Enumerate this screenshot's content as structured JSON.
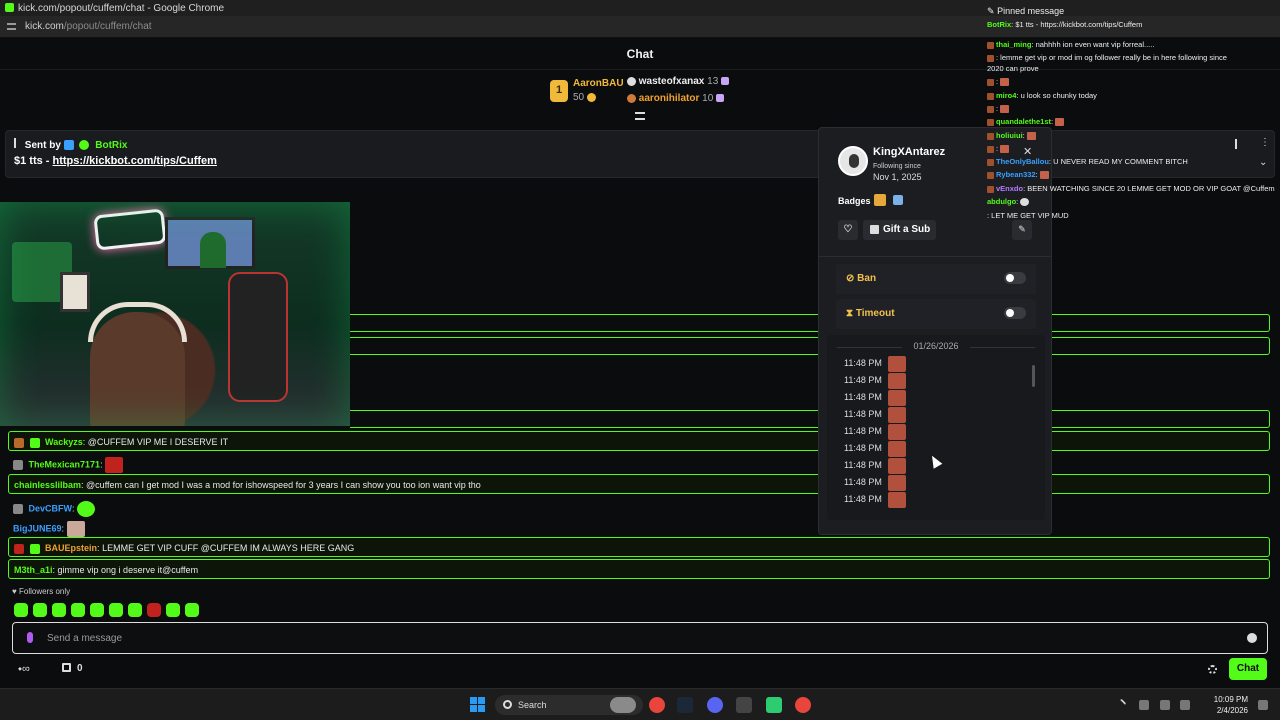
{
  "browser": {
    "window_title": "kick.com/popout/cuffem/chat - Google Chrome",
    "url_domain": "kick.com",
    "url_path": "/popout/cuffem/chat"
  },
  "chat_header": {
    "title": "Chat"
  },
  "leaderboard": {
    "first": {
      "rank": "1",
      "name": "AaronBAU",
      "count": "50"
    },
    "second": {
      "name": "wasteofxanax",
      "count": "13"
    },
    "third": {
      "name": "aaronihilator",
      "count": "10"
    }
  },
  "pinned_banner": {
    "sent_by_label": "Sent by",
    "bot_name": "BotRix",
    "message_prefix": "$1 tts - ",
    "message_link": "https://kickbot.com/tips/Cuffem"
  },
  "chat_rows": [
    {
      "user": "Wackyzs",
      "text": "@CUFFEM VIP ME I DESERVE IT",
      "color": "#53fc18",
      "highlighted": true
    },
    {
      "user": "TheMexican7171",
      "text": "",
      "color": "#53fc18",
      "highlighted": false
    },
    {
      "user": "chainlesslilbam",
      "text": "@cuffem can I get mod I was a mod for ishowspeed for 3 years I can show you too ion want vip tho",
      "color": "#53fc18",
      "highlighted": true
    },
    {
      "user": "DevCBFW",
      "text": "",
      "color": "#3aa0ff",
      "highlighted": false
    },
    {
      "user": "BigJUNE69",
      "text": "",
      "color": "#3aa0ff",
      "highlighted": false
    },
    {
      "user": "BAUEpstein",
      "text": "LEMME GET VIP CUFF @CUFFEM IM ALWAYS HERE GANG",
      "color": "#f0a030",
      "highlighted": true
    },
    {
      "user": "M3th_a1i",
      "text": "gimme vip ong i deserve it@cuffem",
      "color": "#53fc18",
      "highlighted": true
    }
  ],
  "profile": {
    "username": "KingXAntarez",
    "following_since_label": "Following since",
    "following_since_date": "Nov 1, 2025",
    "badges_label": "Badges",
    "gift_button": "Gift a Sub",
    "ban_label": "Ban",
    "timeout_label": "Timeout",
    "history_date": "01/26/2026",
    "history_times": [
      "11:48 PM",
      "11:48 PM",
      "11:48 PM",
      "11:48 PM",
      "11:48 PM",
      "11:48 PM",
      "11:48 PM",
      "11:48 PM",
      "11:48 PM"
    ]
  },
  "overlay": {
    "pinned_label": "Pinned message",
    "pinned_user": "BotRix",
    "pinned_text": "$1 tts - https://kickbot.com/tips/Cuffem",
    "rows": [
      {
        "user": "thai_ming",
        "text": "nahhhh ion even want vip forreal.....",
        "color": "#53fc18"
      },
      {
        "user": "",
        "text": "lemme get vip or mod im og follower really be in here following since",
        "color": "#e05050"
      },
      {
        "user": "",
        "text": "2020 can prove",
        "color": "#eee"
      },
      {
        "user": "",
        "text": "",
        "color": "#e05050"
      },
      {
        "user": "miro4",
        "text": "u look so chunky today",
        "color": "#53fc18"
      },
      {
        "user": "",
        "text": "",
        "color": "#e05050"
      },
      {
        "user": "quandalethe1st",
        "text": "",
        "color": "#53fc18"
      },
      {
        "user": "holiuiui",
        "text": "",
        "color": "#53fc18"
      },
      {
        "user": "",
        "text": "",
        "color": "#e05050"
      },
      {
        "user": "TheOnlyBallou",
        "text": "U NEVER READ MY COMMENT BITCH",
        "color": "#3aa0ff"
      },
      {
        "user": "Rybean332",
        "text": "",
        "color": "#3aa0ff"
      },
      {
        "user": "vEnxdo",
        "text": "BEEN WATCHING SINCE 20 LEMME GET MOD OR VIP GOAT @Cuffem",
        "color": "#b07cff"
      },
      {
        "user": "abdulgo",
        "text": "",
        "color": "#53fc18"
      },
      {
        "user": "",
        "text": "LET ME GET VIP MUD",
        "color": "#e05050"
      }
    ]
  },
  "bottom": {
    "followers_only": "Followers only",
    "input_placeholder": "Send a message",
    "points": "0",
    "chat_button": "Chat"
  },
  "taskbar": {
    "search_label": "Search",
    "time": "10:09 PM",
    "date": "2/4/2026"
  },
  "colors": {
    "accent": "#53fc18",
    "gold": "#f0b93a",
    "panel": "#1c1d21"
  }
}
